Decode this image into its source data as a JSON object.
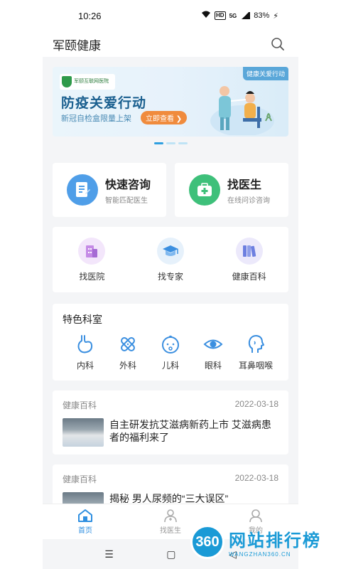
{
  "status": {
    "time": "10:26",
    "hd": "HD",
    "network": "5G",
    "battery": "83%"
  },
  "app": {
    "title": "军颐健康"
  },
  "banner": {
    "logo_text": "军颐互联网医院",
    "headline": "防疫关爱行动",
    "subtitle": "新冠自检盒限量上架",
    "button": "立即查看 ❯",
    "tag": "健康关爱行动"
  },
  "quick": [
    {
      "title": "快速咨询",
      "subtitle": "智能匹配医生",
      "icon": "document-icon",
      "color": "#4f9ee8"
    },
    {
      "title": "找医生",
      "subtitle": "在线问诊咨询",
      "icon": "medical-kit-icon",
      "color": "#3ec07a"
    }
  ],
  "entries": [
    {
      "label": "找医院",
      "icon": "hospital-icon",
      "bg": "#f3e6fb"
    },
    {
      "label": "找专家",
      "icon": "graduation-cap-icon",
      "bg": "#e6f1fb"
    },
    {
      "label": "健康百科",
      "icon": "books-icon",
      "bg": "#ece9fb"
    }
  ],
  "departments": {
    "title": "特色科室",
    "items": [
      {
        "label": "内科",
        "icon": "stomach-icon"
      },
      {
        "label": "外科",
        "icon": "bandage-icon"
      },
      {
        "label": "儿科",
        "icon": "baby-icon"
      },
      {
        "label": "眼科",
        "icon": "eye-icon"
      },
      {
        "label": "耳鼻咽喉",
        "icon": "head-profile-icon"
      }
    ]
  },
  "news": [
    {
      "category": "健康百科",
      "date": "2022-03-18",
      "title": "自主研发抗艾滋病新药上市 艾滋病患者的福利来了"
    },
    {
      "category": "健康百科",
      "date": "2022-03-18",
      "title": "揭秘 男人尿频的“三大误区”"
    }
  ],
  "tabs": [
    {
      "label": "首页",
      "icon": "home-icon",
      "active": true
    },
    {
      "label": "找医生",
      "icon": "doctor-icon",
      "active": false
    },
    {
      "label": "我的",
      "icon": "user-icon",
      "active": false
    }
  ],
  "navbar": {
    "menu": "☰",
    "home": "▢",
    "back": "◁"
  },
  "watermark": {
    "logo": "360",
    "cn": "网站排行榜",
    "en": "WANGZHAN360.CN"
  },
  "colors": {
    "accent": "#2f8fe0",
    "brand_blue": "#1a5f8f",
    "orange": "#f08b3d"
  }
}
